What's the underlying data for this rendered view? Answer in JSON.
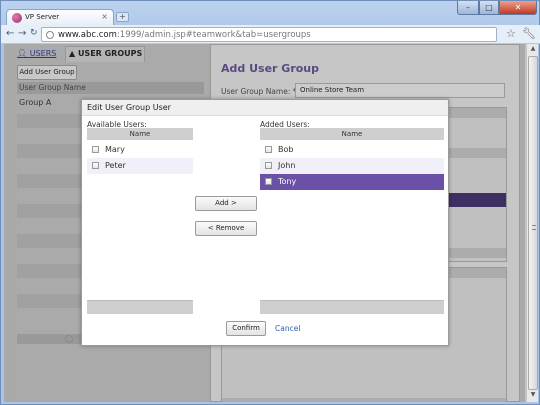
{
  "browser": {
    "tab_title": "VP Server",
    "tab_close": "×",
    "new_tab": "+",
    "url_host": "www.abc.com",
    "url_rest": ":1999/admin.jsp#teamwork&tab=usergroups",
    "controls": {
      "minimize": "–",
      "maximize": "□",
      "close": "✕"
    },
    "back": "←",
    "forward": "→",
    "reload": "C"
  },
  "left_panel": {
    "tab_users": "USERS",
    "tab_user_groups": "USER GROUPS",
    "add_group_label": "Add User Group",
    "column_header": "User Group Name",
    "rows": [
      "Group A"
    ]
  },
  "right_panel": {
    "heading": "Add User Group",
    "group_name_label": "User Group Name: *",
    "group_name_value": "Online Store Team"
  },
  "dialog": {
    "title": "Edit User Group User",
    "available": {
      "label": "Available Users:",
      "header": "Name",
      "items": [
        "Mary",
        "Peter"
      ]
    },
    "added": {
      "label": "Added Users:",
      "header": "Name",
      "items": [
        "Bob",
        "John",
        "Tony"
      ],
      "selected_index": 2
    },
    "add_label": "Add >",
    "remove_label": "< Remove",
    "confirm_label": "Confirm",
    "cancel_label": "Cancel"
  },
  "colors": {
    "accent_purple": "#6a50a6",
    "heading_purple": "#5a4a80",
    "link_blue": "#2c5fb0"
  }
}
